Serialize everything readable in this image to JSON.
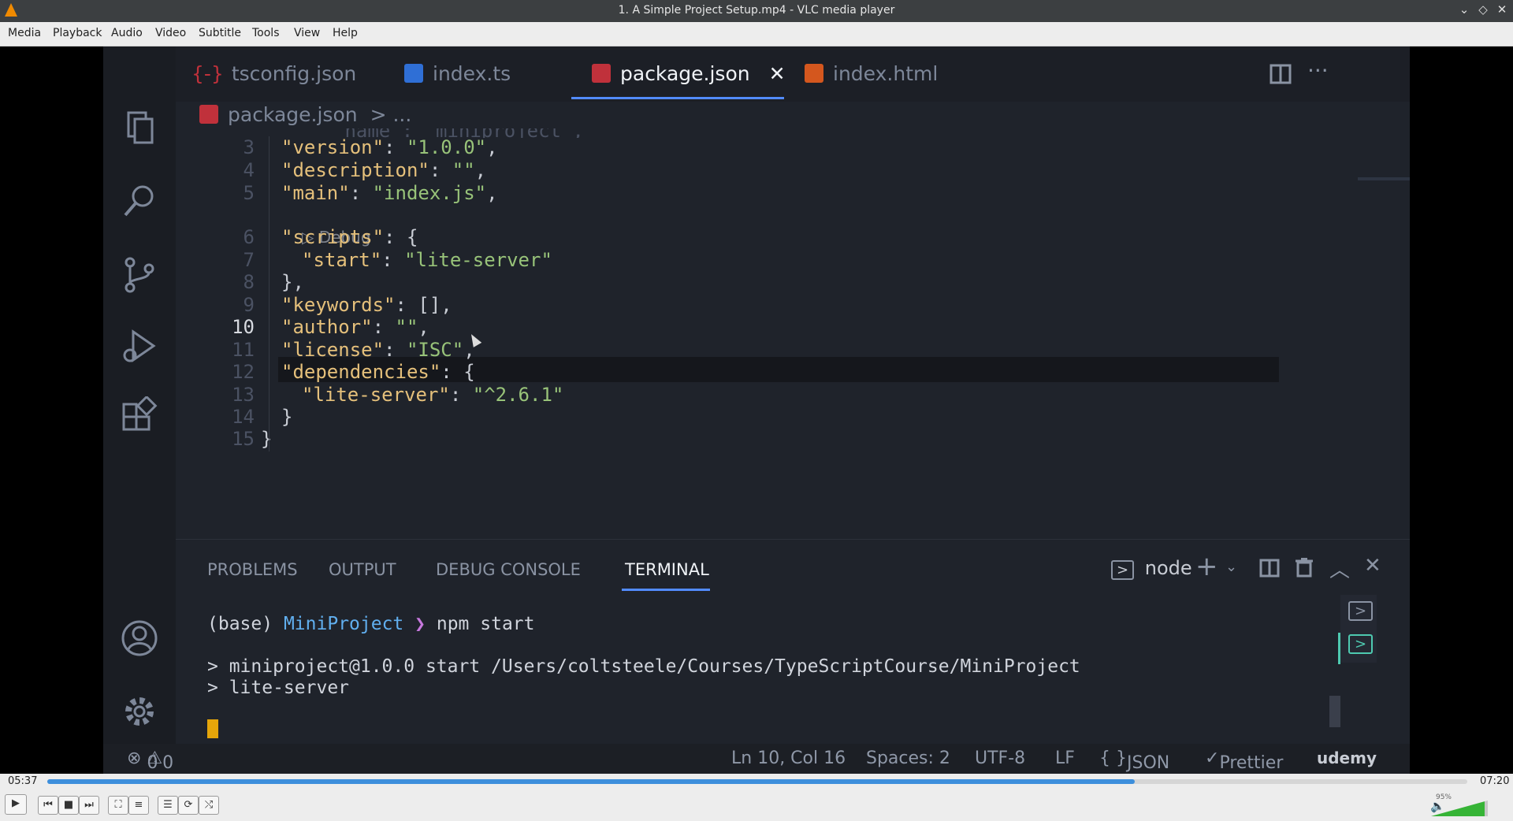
{
  "window": {
    "title": "1. A Simple Project Setup.mp4 - VLC media player"
  },
  "menu": [
    "Media",
    "Playback",
    "Audio",
    "Video",
    "Subtitle",
    "Tools",
    "View",
    "Help"
  ],
  "vscode": {
    "tabs": [
      {
        "label": "tsconfig.json",
        "icon": "json-braces-icon"
      },
      {
        "label": "index.ts",
        "icon": "typescript-icon"
      },
      {
        "label": "package.json",
        "icon": "npm-icon",
        "active": true
      },
      {
        "label": "index.html",
        "icon": "html5-icon"
      }
    ],
    "close_glyph": "✕",
    "breadcrumb": {
      "file": "package.json",
      "rest": "> ..."
    },
    "codelens": "▷ Debug",
    "lines": [
      {
        "n": "3",
        "key": "\"version\"",
        "sep": ": ",
        "val": "\"1.0.0\"",
        "end": ","
      },
      {
        "n": "4",
        "key": "\"description\"",
        "sep": ": ",
        "val": "\"\"",
        "end": ","
      },
      {
        "n": "5",
        "key": "\"main\"",
        "sep": ": ",
        "val": "\"index.js\"",
        "end": ","
      },
      {
        "n": "6",
        "key": "\"scripts\"",
        "sep": ": ",
        "val": "",
        "end": "{"
      },
      {
        "n": "7",
        "key": "\"start\"",
        "sep": ": ",
        "val": "\"lite-server\"",
        "end": ""
      },
      {
        "n": "8",
        "key": "",
        "sep": "",
        "val": "",
        "end": "},"
      },
      {
        "n": "9",
        "key": "\"keywords\"",
        "sep": ": ",
        "val": "",
        "end": "[],"
      },
      {
        "n": "10",
        "key": "\"author\"",
        "sep": ": ",
        "val": "\"\"",
        "end": ","
      },
      {
        "n": "11",
        "key": "\"license\"",
        "sep": ": ",
        "val": "\"ISC\"",
        "end": ","
      },
      {
        "n": "12",
        "key": "\"dependencies\"",
        "sep": ": ",
        "val": "",
        "end": "{"
      },
      {
        "n": "13",
        "key": "\"lite-server\"",
        "sep": ": ",
        "val": "\"^2.6.1\"",
        "end": ""
      },
      {
        "n": "14",
        "key": "",
        "sep": "",
        "val": "",
        "end": "}"
      },
      {
        "n": "15",
        "key": "",
        "sep": "",
        "val": "",
        "end": "}"
      }
    ],
    "panel_tabs": [
      "PROBLEMS",
      "OUTPUT",
      "DEBUG CONSOLE",
      "TERMINAL"
    ],
    "terminal": {
      "shell": "node",
      "prompt_env": "(base)",
      "prompt_dir": "MiniProject",
      "prompt_arrow": "❯",
      "command": "npm start",
      "output1": "> miniproject@1.0.0 start /Users/coltsteele/Courses/TypeScriptCourse/MiniProject",
      "output2": "> lite-server"
    },
    "status": {
      "errors": "0",
      "warnings": "0",
      "position": "Ln 10, Col 16",
      "spaces": "Spaces: 2",
      "encoding": "UTF-8",
      "eol": "LF",
      "language": "JSON",
      "formatter": "Prettier",
      "watermark": "udemy"
    }
  },
  "player": {
    "elapsed": "05:37",
    "total": "07:20",
    "progress": 0.766,
    "volume_label": "95%",
    "volume": 0.95
  },
  "colors": {
    "accent": "#528bff",
    "vlc_orange": "#f08a00",
    "seek": "#3d8fdc"
  }
}
